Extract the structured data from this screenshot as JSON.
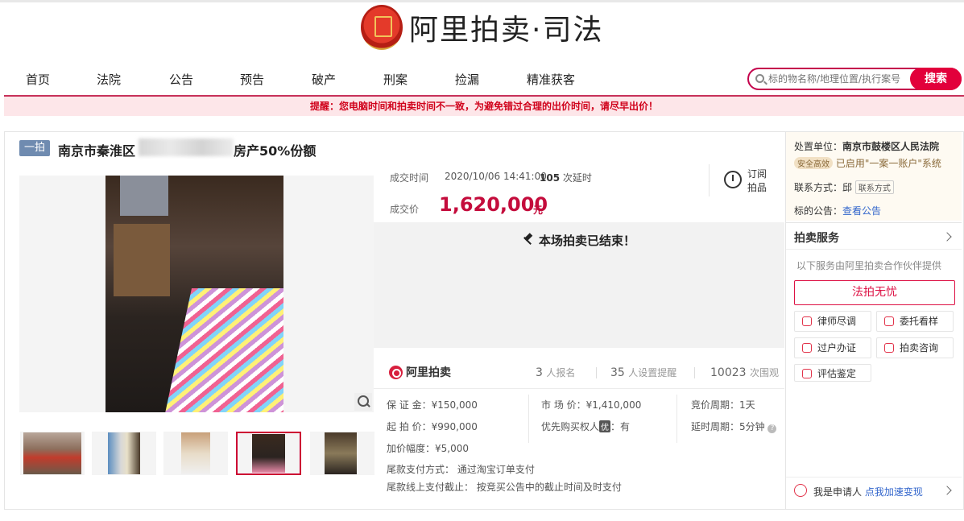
{
  "brand": {
    "name": "阿里拍卖·司法"
  },
  "nav": [
    "首页",
    "法院",
    "公告",
    "预告",
    "破产",
    "刑案",
    "捡漏",
    "精准获客"
  ],
  "search": {
    "placeholder": "标的物名称/地理位置/执行案号",
    "button": "搜索"
  },
  "notice": "提醒：您电脑时间和拍卖时间不一致，为避免错过合理的出价时间，请尽早出价！",
  "item": {
    "round_badge": "一拍",
    "title_prefix": "南京市秦淮区",
    "title_suffix": "房产50%份额"
  },
  "deal": {
    "time_label": "成交时间",
    "time_value": "2020/10/06 14:41:00",
    "delay_count": "105",
    "delay_suffix": "次延时",
    "price_label": "成交价",
    "price_value": "1,620,000",
    "price_unit": "元",
    "subscribe_label": "订阅拍品",
    "ended_text": "本场拍卖已结束！"
  },
  "stats": {
    "platform": "阿里拍卖",
    "signups": "3",
    "signups_label": "人报名",
    "reminders": "35",
    "reminders_label": "人设置提醒",
    "views": "10023",
    "views_label": "次围观"
  },
  "details": {
    "deposit": "保 证 金：¥150,000",
    "start_price": "起 拍 价：¥990,000",
    "increment": "加价幅度：¥5,000",
    "market_price": "市 场 价：¥1,410,000",
    "priority_label": "优先购买权人",
    "priority_badge": "优",
    "priority_value": "：有",
    "bid_cycle": "竞价周期：1天",
    "delay_cycle": "延时周期：5分钟",
    "payment_method": "尾款支付方式：  通过淘宝订单支付",
    "payment_deadline": "尾款线上支付截止：  按竞买公告中的截止时间及时支付"
  },
  "side": {
    "unit_label": "处置单位：",
    "unit_value": "南京市鼓楼区人民法院",
    "safe_badge": "安全高效",
    "system_text": "已启用\"一案一账户\"系统",
    "contact_label": "联系方式：",
    "contact_name": "邱",
    "contact_button": "联系方式",
    "announcement_label": "标的公告：",
    "announcement_link": "查看公告",
    "service_title": "拍卖服务",
    "service_note": "以下服务由阿里拍卖合作伙伴提供",
    "fapai_button": "法拍无忧",
    "services": [
      "律师尽调",
      "委托看样",
      "过户办证",
      "拍卖咨询",
      "评估鉴定"
    ],
    "apply_prefix": "我是申请人",
    "apply_link": "点我加速变现"
  }
}
